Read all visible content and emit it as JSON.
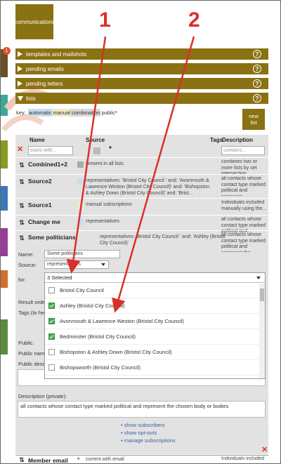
{
  "app": {
    "tile_label": "communications",
    "badge": "1"
  },
  "sections": [
    {
      "label": "templates and mailshots"
    },
    {
      "label": "pending emails"
    },
    {
      "label": "pending letters"
    },
    {
      "label": "lists"
    }
  ],
  "help_glyph": "?",
  "key": {
    "prefix": "key:",
    "auto": "automatic",
    "manual": "manual",
    "combination": "combination",
    "public": "public*"
  },
  "new_list_label": "new\nlist",
  "columns": {
    "name": "Name",
    "source": "Source",
    "tags": "Tags",
    "description": "Description"
  },
  "filters": {
    "name_placeholder": "starts with...",
    "desc_placeholder": "contains...",
    "star": "*"
  },
  "rows": [
    {
      "name": "Combined1+2",
      "source": "present in all lists",
      "description": "combines two or more lists by set intersection...",
      "color": "#aaaaaa"
    },
    {
      "name": "Source2",
      "source": "representatives: 'Bristol City Council ' and: 'Avonmouth & Lawrence Weston (Bristol City Council)' and: 'Bishopston & Ashley Down (Bristol City Council)' and: 'Brist...",
      "description": "all contacts whose contact type marked political and represent...",
      "color": "#c8ddeb"
    },
    {
      "name": "Source1",
      "source": "manual subscriptions",
      "description": "Individuals included manually using the...",
      "color": "#f0e8c8"
    },
    {
      "name": "Change me",
      "source": "representatives",
      "description": "all contacts whose contact type marked political and...",
      "color": "#c8ddeb"
    },
    {
      "name": "Some politicians",
      "source": "representatives: 'Bristol City Council ' and: 'Ashley (Bristol City Council)'",
      "description": "all contacts whose contact type marked political and represent the...",
      "color": "#c8ddeb"
    }
  ],
  "form": {
    "name_label": "Name:",
    "name_value": "Some politicians",
    "source_label": "Source:",
    "source_value": "representatives",
    "for_label": "for:",
    "for_value": "3 Selected",
    "result_order_label": "Result order:",
    "tags_label": "Tags (to help f",
    "public_label": "Public:",
    "public_name_label": "Public name:",
    "public_desc_label": "Public descrip",
    "desc_private_label": "Description (private):",
    "desc_private_value": "all contacts whose contact type marked political and represent the chosen body or bodies"
  },
  "options": [
    {
      "label": "Bristol City Council",
      "checked": false
    },
    {
      "label": "Ashley (Bristol City Council)",
      "checked": true
    },
    {
      "label": "Avonmouth & Lawrence Weston (Bristol City Council)",
      "checked": true
    },
    {
      "label": "Bedminster (Bristol City Council)",
      "checked": true
    },
    {
      "label": "Bishopston & Ashley Down (Bristol City Council)",
      "checked": false
    },
    {
      "label": "Bishopsworth (Bristol City Council)",
      "checked": false
    }
  ],
  "links": [
    "• show subscribers",
    "• show opt-outs",
    "• manage subscriptions"
  ],
  "bottom_row": {
    "name": "Member email",
    "source": "current with email",
    "description": "Individuals included",
    "star": "*"
  },
  "annotations": {
    "one": "1",
    "two": "2",
    "color": "#d9302c"
  }
}
